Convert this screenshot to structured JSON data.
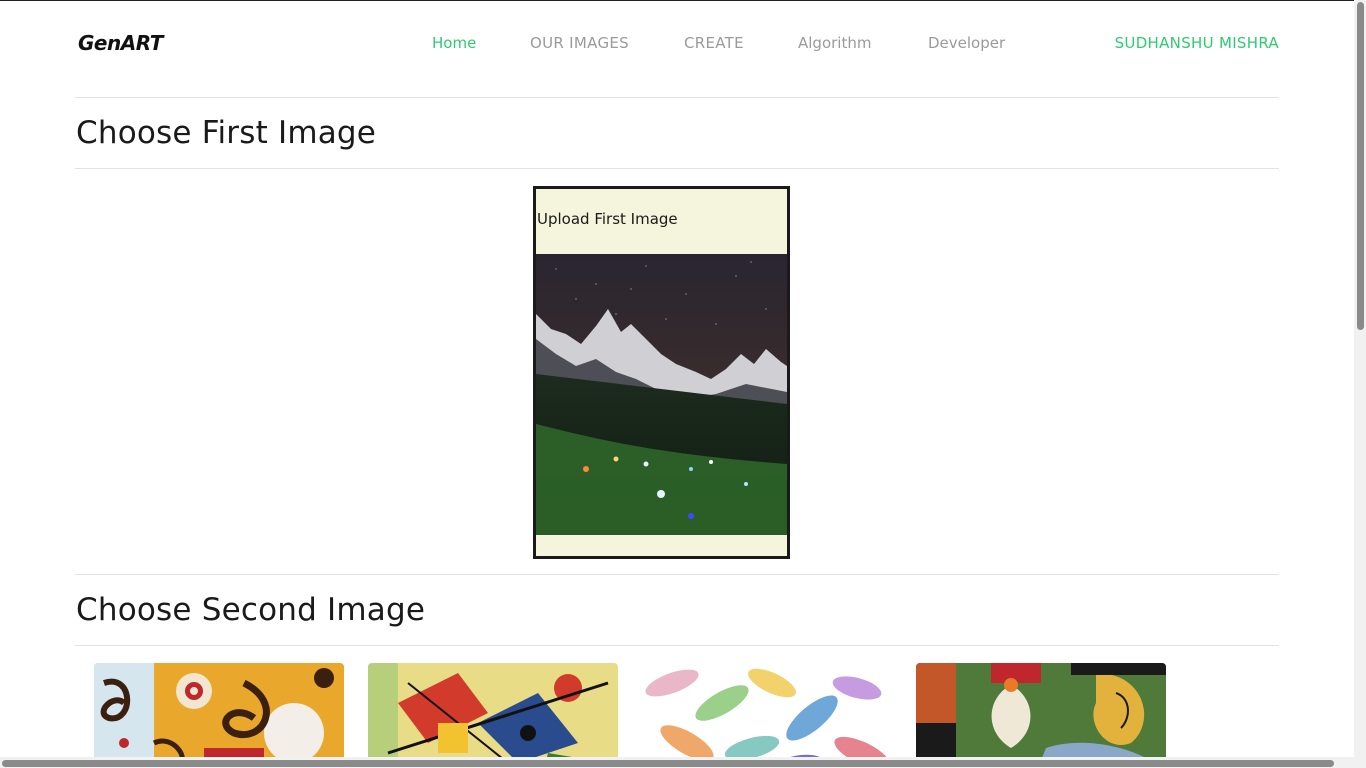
{
  "nav": {
    "brand": "GenART",
    "links": [
      {
        "label": "Home",
        "active": true
      },
      {
        "label": "OUR IMAGES",
        "active": false
      },
      {
        "label": "CREATE",
        "active": false
      },
      {
        "label": "Algorithm",
        "active": false
      },
      {
        "label": "Developer",
        "active": false
      }
    ],
    "user": "SUDHANSHU MISHRA"
  },
  "first_section": {
    "title": "Choose First Image",
    "upload_label": "Upload First Image",
    "preview_icon": "night-mountain-village-photo"
  },
  "second_section": {
    "title": "Choose Second Image",
    "style_images": [
      {
        "icon": "swirl-tree-painting"
      },
      {
        "icon": "abstract-kandinsky-painting"
      },
      {
        "icon": "watercolor-feathers-painting"
      },
      {
        "icon": "cubist-portrait-painting"
      }
    ]
  },
  "colors": {
    "accent": "#2ecc71",
    "nav_muted": "#9a9a9a",
    "upload_bg": "#f5f4dc"
  }
}
